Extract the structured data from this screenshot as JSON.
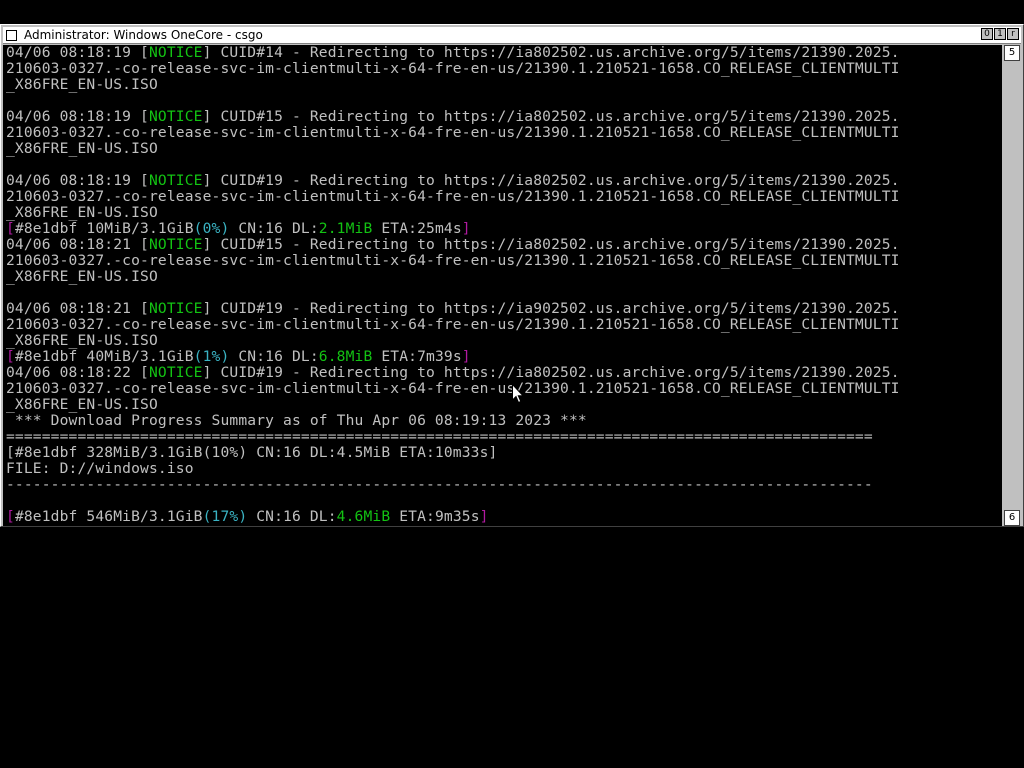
{
  "window": {
    "title": "Administrator:  Windows OneCore - csgo",
    "buttons": {
      "minimize": "0",
      "maximize": "1",
      "close": "r"
    },
    "scrollbar": {
      "up": "5",
      "down": "6"
    }
  },
  "console": {
    "lines": [
      [
        {
          "t": "04/06 08:18:19 ["
        },
        {
          "t": "NOTICE",
          "c": "green"
        },
        {
          "t": "] CUID#14 - Redirecting to https://ia802502.us.archive.org/5/items/21390.2025."
        }
      ],
      [
        {
          "t": "210603-0327.-co-release-svc-im-clientmulti-x-64-fre-en-us/21390.1.210521-1658.CO_RELEASE_CLIENTMULTI"
        }
      ],
      [
        {
          "t": "_X86FRE_EN-US.ISO"
        }
      ],
      [
        {
          "t": ""
        }
      ],
      [
        {
          "t": "04/06 08:18:19 ["
        },
        {
          "t": "NOTICE",
          "c": "green"
        },
        {
          "t": "] CUID#15 - Redirecting to https://ia802502.us.archive.org/5/items/21390.2025."
        }
      ],
      [
        {
          "t": "210603-0327.-co-release-svc-im-clientmulti-x-64-fre-en-us/21390.1.210521-1658.CO_RELEASE_CLIENTMULTI"
        }
      ],
      [
        {
          "t": "_X86FRE_EN-US.ISO"
        }
      ],
      [
        {
          "t": ""
        }
      ],
      [
        {
          "t": "04/06 08:18:19 ["
        },
        {
          "t": "NOTICE",
          "c": "green"
        },
        {
          "t": "] CUID#19 - Redirecting to https://ia802502.us.archive.org/5/items/21390.2025."
        }
      ],
      [
        {
          "t": "210603-0327.-co-release-svc-im-clientmulti-x-64-fre-en-us/21390.1.210521-1658.CO_RELEASE_CLIENTMULTI"
        }
      ],
      [
        {
          "t": "_X86FRE_EN-US.ISO"
        }
      ],
      [
        {
          "t": "[",
          "c": "mag"
        },
        {
          "t": "#8e1dbf 10MiB/3.1GiB"
        },
        {
          "t": "(0%)",
          "c": "cyan"
        },
        {
          "t": " CN:16 DL:"
        },
        {
          "t": "2.1MiB",
          "c": "green"
        },
        {
          "t": " ETA:25m4s"
        },
        {
          "t": "]",
          "c": "mag"
        }
      ],
      [
        {
          "t": "04/06 08:18:21 ["
        },
        {
          "t": "NOTICE",
          "c": "green"
        },
        {
          "t": "] CUID#15 - Redirecting to https://ia802502.us.archive.org/5/items/21390.2025."
        }
      ],
      [
        {
          "t": "210603-0327.-co-release-svc-im-clientmulti-x-64-fre-en-us/21390.1.210521-1658.CO_RELEASE_CLIENTMULTI"
        }
      ],
      [
        {
          "t": "_X86FRE_EN-US.ISO"
        }
      ],
      [
        {
          "t": ""
        }
      ],
      [
        {
          "t": "04/06 08:18:21 ["
        },
        {
          "t": "NOTICE",
          "c": "green"
        },
        {
          "t": "] CUID#19 - Redirecting to https://ia902502.us.archive.org/5/items/21390.2025."
        }
      ],
      [
        {
          "t": "210603-0327.-co-release-svc-im-clientmulti-x-64-fre-en-us/21390.1.210521-1658.CO_RELEASE_CLIENTMULTI"
        }
      ],
      [
        {
          "t": "_X86FRE_EN-US.ISO"
        }
      ],
      [
        {
          "t": "[",
          "c": "mag"
        },
        {
          "t": "#8e1dbf 40MiB/3.1GiB"
        },
        {
          "t": "(1%)",
          "c": "cyan"
        },
        {
          "t": " CN:16 DL:"
        },
        {
          "t": "6.8MiB",
          "c": "green"
        },
        {
          "t": " ETA:7m39s"
        },
        {
          "t": "]",
          "c": "mag"
        }
      ],
      [
        {
          "t": "04/06 08:18:22 ["
        },
        {
          "t": "NOTICE",
          "c": "green"
        },
        {
          "t": "] CUID#19 - Redirecting to https://ia802502.us.archive.org/5/items/21390.2025."
        }
      ],
      [
        {
          "t": "210603-0327.-co-release-svc-im-clientmulti-x-64-fre-en-us/21390.1.210521-1658.CO_RELEASE_CLIENTMULTI"
        }
      ],
      [
        {
          "t": "_X86FRE_EN-US.ISO"
        }
      ],
      [
        {
          "t": " *** Download Progress Summary as of Thu Apr 06 08:19:13 2023 ***"
        }
      ],
      [
        {
          "t": "================================================================================================="
        }
      ],
      [
        {
          "t": "[#8e1dbf 328MiB/3.1GiB(10%) CN:16 DL:4.5MiB ETA:10m33s]"
        }
      ],
      [
        {
          "t": "FILE: D://windows.iso"
        }
      ],
      [
        {
          "t": "-------------------------------------------------------------------------------------------------"
        }
      ],
      [
        {
          "t": ""
        }
      ],
      [
        {
          "t": "[",
          "c": "mag"
        },
        {
          "t": "#8e1dbf 546MiB/3.1GiB"
        },
        {
          "t": "(17%)",
          "c": "cyan"
        },
        {
          "t": " CN:16 DL:"
        },
        {
          "t": "4.6MiB",
          "c": "green"
        },
        {
          "t": " ETA:9m35s"
        },
        {
          "t": "]",
          "c": "mag"
        }
      ]
    ]
  }
}
